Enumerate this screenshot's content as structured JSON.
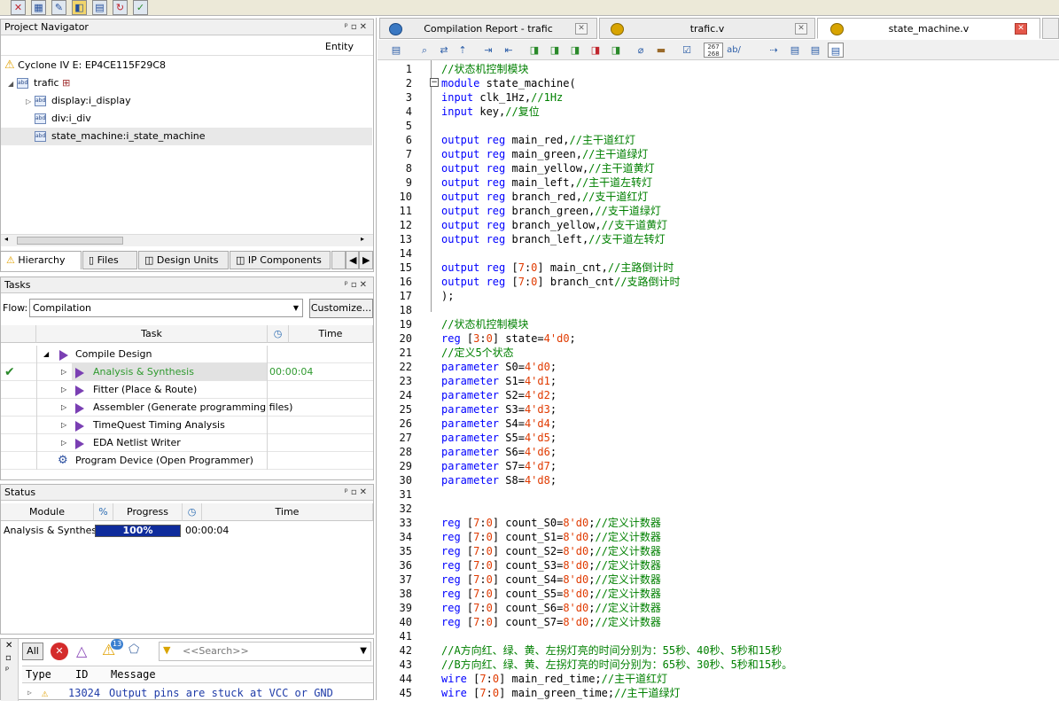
{
  "toolbar": {
    "icons": [
      "x-icon",
      "build-icon",
      "pencil-icon",
      "chip-icon",
      "grid-icon",
      "refresh-icon",
      "check-icon"
    ]
  },
  "navigator": {
    "title": "Project Navigator",
    "entity_header": "Entity",
    "device": "Cyclone IV E: EP4CE115F29C8",
    "top": "trafic",
    "children": [
      "display:i_display",
      "div:i_div",
      "state_machine:i_state_machine"
    ],
    "tabs": [
      "Hierarchy",
      "Files",
      "Design Units",
      "IP Components"
    ]
  },
  "tasks": {
    "title": "Tasks",
    "flow_label": "Flow:",
    "flow_value": "Compilation",
    "customize": "Customize...",
    "col_task": "Task",
    "col_time": "Time",
    "rows": [
      {
        "label": "Compile Design",
        "time": ""
      },
      {
        "label": "Analysis & Synthesis",
        "time": "00:00:04"
      },
      {
        "label": "Fitter (Place & Route)",
        "time": ""
      },
      {
        "label": "Assembler (Generate programming files)",
        "time": ""
      },
      {
        "label": "TimeQuest Timing Analysis",
        "time": ""
      },
      {
        "label": "EDA Netlist Writer",
        "time": ""
      },
      {
        "label": "Program Device (Open Programmer)",
        "time": ""
      }
    ]
  },
  "status": {
    "title": "Status",
    "col_module": "Module",
    "col_pct": "%",
    "col_progress": "Progress",
    "col_time": "Time",
    "row_module": "Analysis & Synthesis",
    "row_progress_text": "100%",
    "row_progress_value": 100,
    "row_time": "00:00:04"
  },
  "messages": {
    "all_label": "All",
    "badge_count": "13",
    "search_placeholder": "<<Search>>",
    "col_type": "Type",
    "col_id": "ID",
    "col_message": "Message",
    "row_id": "13024",
    "row_text": "Output pins are stuck at VCC or GND"
  },
  "editor": {
    "tabs": [
      "Compilation Report - trafic",
      "trafic.v",
      "state_machine.v"
    ],
    "ruler_text": "267\n268",
    "ab_text": "ab/",
    "lines": [
      {
        "n": "1",
        "segs": [
          [
            "cm",
            "//状态机控制模块"
          ]
        ]
      },
      {
        "n": "2",
        "segs": [
          [
            "kw",
            "module"
          ],
          [
            "tx",
            " state_machine("
          ]
        ]
      },
      {
        "n": "3",
        "segs": [
          [
            "kw",
            "input"
          ],
          [
            "tx",
            " clk_1Hz,"
          ],
          [
            "cm",
            "//1Hz"
          ]
        ]
      },
      {
        "n": "4",
        "segs": [
          [
            "kw",
            "input"
          ],
          [
            "tx",
            " key,"
          ],
          [
            "cm",
            "//复位"
          ]
        ]
      },
      {
        "n": "5",
        "segs": []
      },
      {
        "n": "6",
        "segs": [
          [
            "kw",
            "output reg"
          ],
          [
            "tx",
            " main_red,"
          ],
          [
            "cm",
            "//主干道红灯"
          ]
        ]
      },
      {
        "n": "7",
        "segs": [
          [
            "kw",
            "output reg"
          ],
          [
            "tx",
            " main_green,"
          ],
          [
            "cm",
            "//主干道绿灯"
          ]
        ]
      },
      {
        "n": "8",
        "segs": [
          [
            "kw",
            "output reg"
          ],
          [
            "tx",
            " main_yellow,"
          ],
          [
            "cm",
            "//主干道黄灯"
          ]
        ]
      },
      {
        "n": "9",
        "segs": [
          [
            "kw",
            "output reg"
          ],
          [
            "tx",
            " main_left,"
          ],
          [
            "cm",
            "//主干道左转灯"
          ]
        ]
      },
      {
        "n": "10",
        "segs": [
          [
            "kw",
            "output reg"
          ],
          [
            "tx",
            " branch_red,"
          ],
          [
            "cm",
            "//支干道红灯"
          ]
        ]
      },
      {
        "n": "11",
        "segs": [
          [
            "kw",
            "output reg"
          ],
          [
            "tx",
            " branch_green,"
          ],
          [
            "cm",
            "//支干道绿灯"
          ]
        ]
      },
      {
        "n": "12",
        "segs": [
          [
            "kw",
            "output reg"
          ],
          [
            "tx",
            " branch_yellow,"
          ],
          [
            "cm",
            "//支干道黄灯"
          ]
        ]
      },
      {
        "n": "13",
        "segs": [
          [
            "kw",
            "output reg"
          ],
          [
            "tx",
            " branch_left,"
          ],
          [
            "cm",
            "//支干道左转灯"
          ]
        ]
      },
      {
        "n": "14",
        "segs": []
      },
      {
        "n": "15",
        "segs": [
          [
            "kw",
            "output reg"
          ],
          [
            "tx",
            " ["
          ],
          [
            "nm",
            "7"
          ],
          [
            "tx",
            ":"
          ],
          [
            "nm",
            "0"
          ],
          [
            "tx",
            "] main_cnt,"
          ],
          [
            "cm",
            "//主路倒计时"
          ]
        ]
      },
      {
        "n": "16",
        "segs": [
          [
            "kw",
            "output reg"
          ],
          [
            "tx",
            " ["
          ],
          [
            "nm",
            "7"
          ],
          [
            "tx",
            ":"
          ],
          [
            "nm",
            "0"
          ],
          [
            "tx",
            "] branch_cnt"
          ],
          [
            "cm",
            "//支路倒计时"
          ]
        ]
      },
      {
        "n": "17",
        "segs": [
          [
            "tx",
            ");"
          ]
        ]
      },
      {
        "n": "18",
        "segs": []
      },
      {
        "n": "19",
        "segs": [
          [
            "cm",
            "//状态机控制模块"
          ]
        ]
      },
      {
        "n": "20",
        "segs": [
          [
            "kw",
            "reg"
          ],
          [
            "tx",
            " ["
          ],
          [
            "nm",
            "3"
          ],
          [
            "tx",
            ":"
          ],
          [
            "nm",
            "0"
          ],
          [
            "tx",
            "] state="
          ],
          [
            "nm",
            "4'd0"
          ],
          [
            "tx",
            ";"
          ]
        ]
      },
      {
        "n": "21",
        "segs": [
          [
            "cm",
            "//定义5个状态"
          ]
        ]
      },
      {
        "n": "22",
        "segs": [
          [
            "kw",
            "parameter"
          ],
          [
            "tx",
            " S0="
          ],
          [
            "nm",
            "4'd0"
          ],
          [
            "tx",
            ";"
          ]
        ]
      },
      {
        "n": "23",
        "segs": [
          [
            "kw",
            "parameter"
          ],
          [
            "tx",
            " S1="
          ],
          [
            "nm",
            "4'd1"
          ],
          [
            "tx",
            ";"
          ]
        ]
      },
      {
        "n": "24",
        "segs": [
          [
            "kw",
            "parameter"
          ],
          [
            "tx",
            " S2="
          ],
          [
            "nm",
            "4'd2"
          ],
          [
            "tx",
            ";"
          ]
        ]
      },
      {
        "n": "25",
        "segs": [
          [
            "kw",
            "parameter"
          ],
          [
            "tx",
            " S3="
          ],
          [
            "nm",
            "4'd3"
          ],
          [
            "tx",
            ";"
          ]
        ]
      },
      {
        "n": "26",
        "segs": [
          [
            "kw",
            "parameter"
          ],
          [
            "tx",
            " S4="
          ],
          [
            "nm",
            "4'd4"
          ],
          [
            "tx",
            ";"
          ]
        ]
      },
      {
        "n": "27",
        "segs": [
          [
            "kw",
            "parameter"
          ],
          [
            "tx",
            " S5="
          ],
          [
            "nm",
            "4'd5"
          ],
          [
            "tx",
            ";"
          ]
        ]
      },
      {
        "n": "28",
        "segs": [
          [
            "kw",
            "parameter"
          ],
          [
            "tx",
            " S6="
          ],
          [
            "nm",
            "4'd6"
          ],
          [
            "tx",
            ";"
          ]
        ]
      },
      {
        "n": "29",
        "segs": [
          [
            "kw",
            "parameter"
          ],
          [
            "tx",
            " S7="
          ],
          [
            "nm",
            "4'd7"
          ],
          [
            "tx",
            ";"
          ]
        ]
      },
      {
        "n": "30",
        "segs": [
          [
            "kw",
            "parameter"
          ],
          [
            "tx",
            " S8="
          ],
          [
            "nm",
            "4'd8"
          ],
          [
            "tx",
            ";"
          ]
        ]
      },
      {
        "n": "31",
        "segs": []
      },
      {
        "n": "32",
        "segs": []
      },
      {
        "n": "33",
        "segs": [
          [
            "kw",
            "reg"
          ],
          [
            "tx",
            " ["
          ],
          [
            "nm",
            "7"
          ],
          [
            "tx",
            ":"
          ],
          [
            "nm",
            "0"
          ],
          [
            "tx",
            "] count_S0="
          ],
          [
            "nm",
            "8'd0"
          ],
          [
            "tx",
            ";"
          ],
          [
            "cm",
            "//定义计数器"
          ]
        ]
      },
      {
        "n": "34",
        "segs": [
          [
            "kw",
            "reg"
          ],
          [
            "tx",
            " ["
          ],
          [
            "nm",
            "7"
          ],
          [
            "tx",
            ":"
          ],
          [
            "nm",
            "0"
          ],
          [
            "tx",
            "] count_S1="
          ],
          [
            "nm",
            "8'd0"
          ],
          [
            "tx",
            ";"
          ],
          [
            "cm",
            "//定义计数器"
          ]
        ]
      },
      {
        "n": "35",
        "segs": [
          [
            "kw",
            "reg"
          ],
          [
            "tx",
            " ["
          ],
          [
            "nm",
            "7"
          ],
          [
            "tx",
            ":"
          ],
          [
            "nm",
            "0"
          ],
          [
            "tx",
            "] count_S2="
          ],
          [
            "nm",
            "8'd0"
          ],
          [
            "tx",
            ";"
          ],
          [
            "cm",
            "//定义计数器"
          ]
        ]
      },
      {
        "n": "36",
        "segs": [
          [
            "kw",
            "reg"
          ],
          [
            "tx",
            " ["
          ],
          [
            "nm",
            "7"
          ],
          [
            "tx",
            ":"
          ],
          [
            "nm",
            "0"
          ],
          [
            "tx",
            "] count_S3="
          ],
          [
            "nm",
            "8'd0"
          ],
          [
            "tx",
            ";"
          ],
          [
            "cm",
            "//定义计数器"
          ]
        ]
      },
      {
        "n": "37",
        "segs": [
          [
            "kw",
            "reg"
          ],
          [
            "tx",
            " ["
          ],
          [
            "nm",
            "7"
          ],
          [
            "tx",
            ":"
          ],
          [
            "nm",
            "0"
          ],
          [
            "tx",
            "] count_S4="
          ],
          [
            "nm",
            "8'd0"
          ],
          [
            "tx",
            ";"
          ],
          [
            "cm",
            "//定义计数器"
          ]
        ]
      },
      {
        "n": "38",
        "segs": [
          [
            "kw",
            "reg"
          ],
          [
            "tx",
            " ["
          ],
          [
            "nm",
            "7"
          ],
          [
            "tx",
            ":"
          ],
          [
            "nm",
            "0"
          ],
          [
            "tx",
            "] count_S5="
          ],
          [
            "nm",
            "8'd0"
          ],
          [
            "tx",
            ";"
          ],
          [
            "cm",
            "//定义计数器"
          ]
        ]
      },
      {
        "n": "39",
        "segs": [
          [
            "kw",
            "reg"
          ],
          [
            "tx",
            " ["
          ],
          [
            "nm",
            "7"
          ],
          [
            "tx",
            ":"
          ],
          [
            "nm",
            "0"
          ],
          [
            "tx",
            "] count_S6="
          ],
          [
            "nm",
            "8'd0"
          ],
          [
            "tx",
            ";"
          ],
          [
            "cm",
            "//定义计数器"
          ]
        ]
      },
      {
        "n": "40",
        "segs": [
          [
            "kw",
            "reg"
          ],
          [
            "tx",
            " ["
          ],
          [
            "nm",
            "7"
          ],
          [
            "tx",
            ":"
          ],
          [
            "nm",
            "0"
          ],
          [
            "tx",
            "] count_S7="
          ],
          [
            "nm",
            "8'd0"
          ],
          [
            "tx",
            ";"
          ],
          [
            "cm",
            "//定义计数器"
          ]
        ]
      },
      {
        "n": "41",
        "segs": []
      },
      {
        "n": "42",
        "segs": [
          [
            "cm",
            "//A方向红、绿、黄、左拐灯亮的时间分别为：55秒、40秒、5秒和15秒"
          ]
        ]
      },
      {
        "n": "43",
        "segs": [
          [
            "cm",
            "//B方向红、绿、黄、左拐灯亮的时间分别为：65秒、30秒、5秒和15秒。"
          ]
        ]
      },
      {
        "n": "44",
        "segs": [
          [
            "kw",
            "wire"
          ],
          [
            "tx",
            " ["
          ],
          [
            "nm",
            "7"
          ],
          [
            "tx",
            ":"
          ],
          [
            "nm",
            "0"
          ],
          [
            "tx",
            "] main_red_time;"
          ],
          [
            "cm",
            "//主干道红灯"
          ]
        ]
      },
      {
        "n": "45",
        "segs": [
          [
            "kw",
            "wire"
          ],
          [
            "tx",
            " ["
          ],
          [
            "nm",
            "7"
          ],
          [
            "tx",
            ":"
          ],
          [
            "nm",
            "0"
          ],
          [
            "tx",
            "] main_green_time;"
          ],
          [
            "cm",
            "//主干道绿灯"
          ]
        ]
      }
    ]
  }
}
